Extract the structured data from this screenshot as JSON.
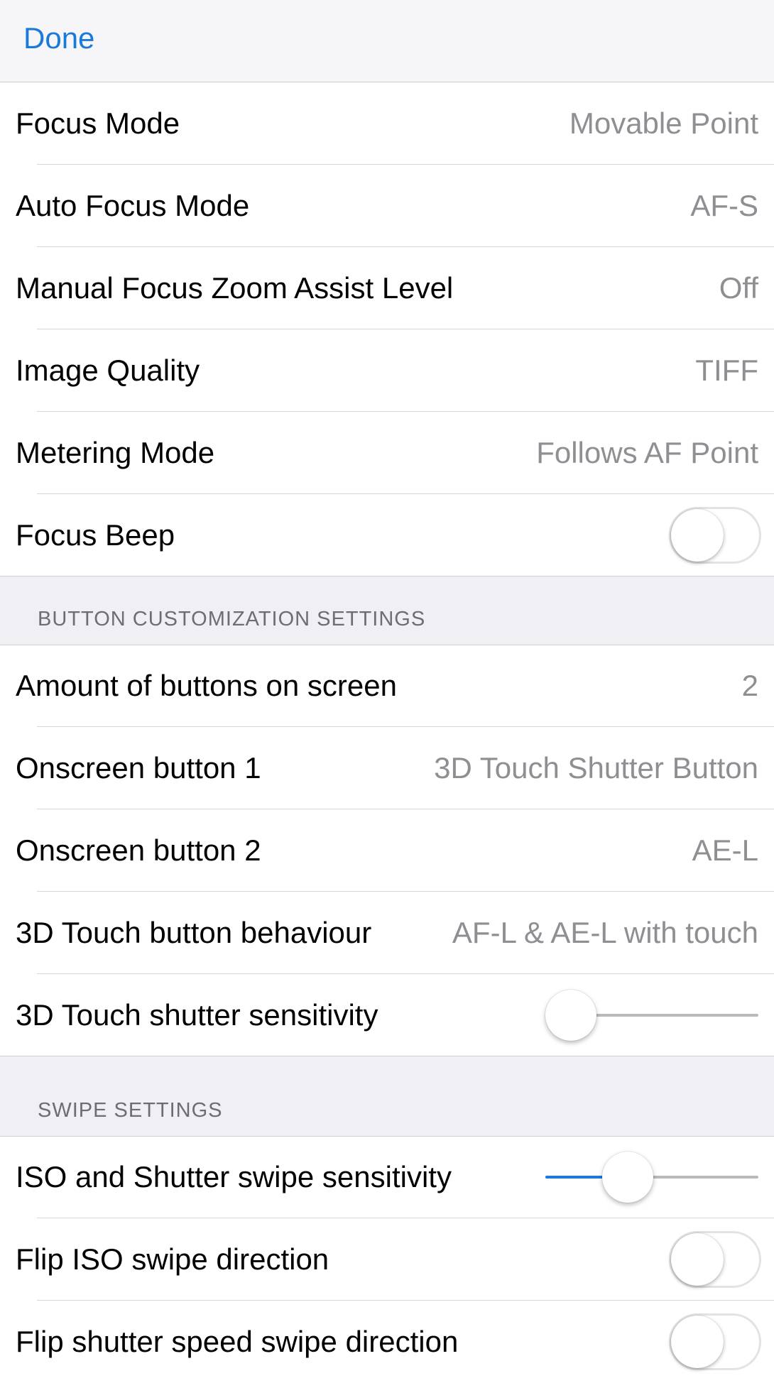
{
  "navbar": {
    "done_label": "Done"
  },
  "camera_group": {
    "rows": [
      {
        "label": "Focus Mode",
        "value": "Movable Point"
      },
      {
        "label": "Auto Focus Mode",
        "value": "AF-S"
      },
      {
        "label": "Manual Focus Zoom Assist Level",
        "value": "Off"
      },
      {
        "label": "Image Quality",
        "value": "TIFF"
      },
      {
        "label": "Metering Mode",
        "value": "Follows AF Point"
      },
      {
        "label": "Focus Beep",
        "toggle_on": false
      }
    ]
  },
  "button_section": {
    "header": "BUTTON CUSTOMIZATION SETTINGS",
    "rows": [
      {
        "label": "Amount of buttons on screen",
        "value": "2"
      },
      {
        "label": "Onscreen button 1",
        "value": "3D Touch Shutter Button"
      },
      {
        "label": "Onscreen button 2",
        "value": "AE-L"
      },
      {
        "label": "3D Touch button behaviour",
        "value": "AF-L & AE-L with touch"
      },
      {
        "label": "3D Touch shutter sensitivity",
        "slider_value": 0.0
      }
    ]
  },
  "swipe_section": {
    "header": "SWIPE SETTINGS",
    "rows": [
      {
        "label": "ISO and Shutter swipe sensitivity",
        "slider_value": 0.35
      },
      {
        "label": "Flip ISO swipe direction",
        "toggle_on": false
      },
      {
        "label": "Flip shutter speed swipe direction",
        "toggle_on": false
      }
    ]
  },
  "colors": {
    "accent": "#1a7ad9",
    "secondary_text": "#8e8e93",
    "grouped_background": "#efeff4"
  }
}
